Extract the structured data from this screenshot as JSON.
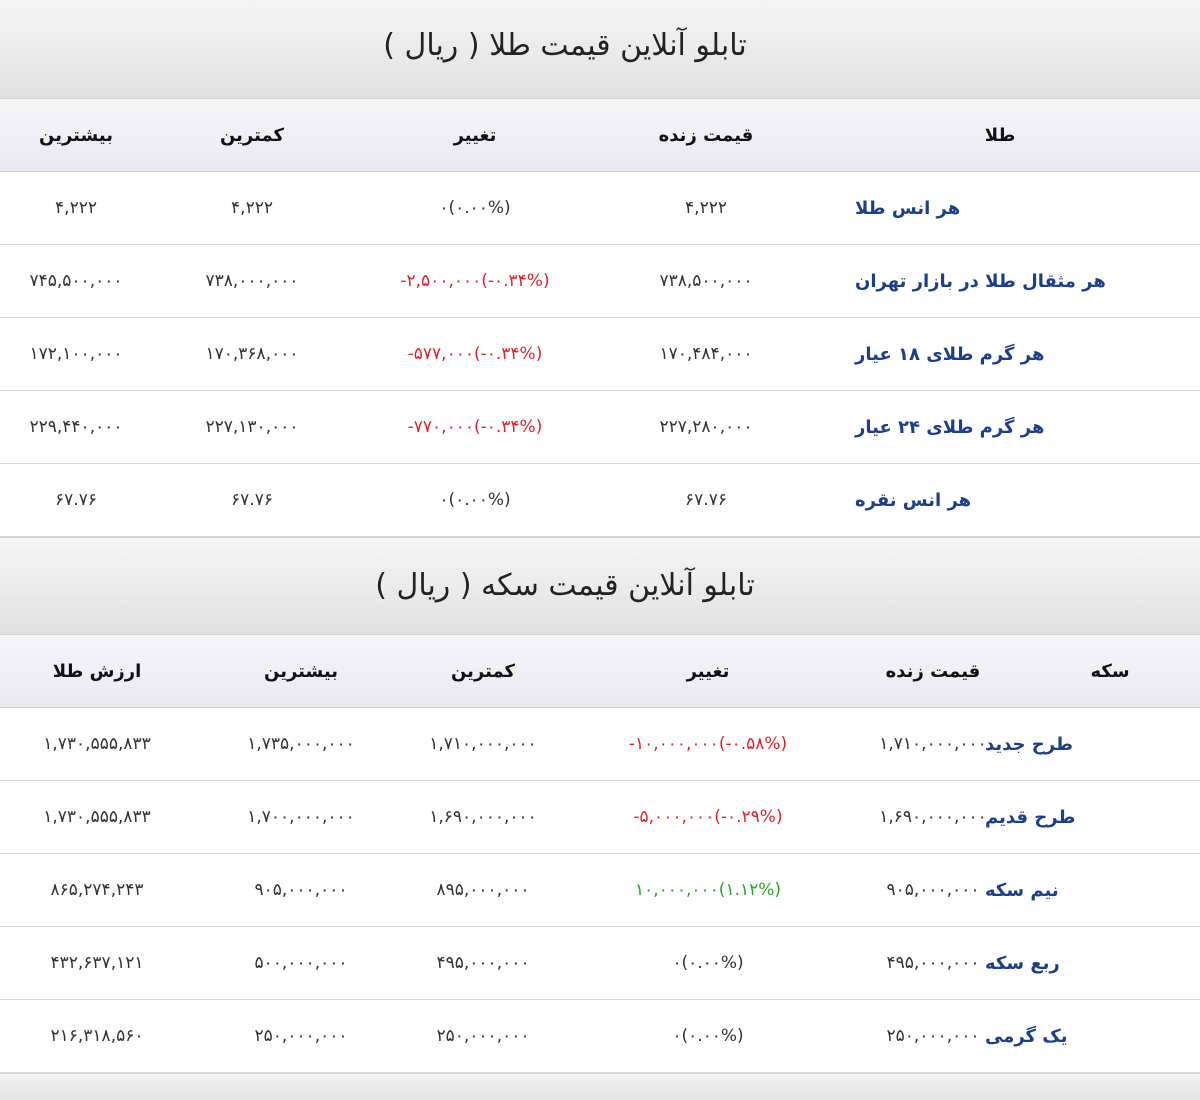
{
  "gold_board": {
    "title": "تابلو آنلاین قیمت طلا ( ریال )",
    "headers": {
      "name": "طلا",
      "live": "قیمت زنده",
      "change": "تغییر",
      "min": "کمترین",
      "max": "بیشترین"
    },
    "rows": [
      {
        "name": "هر انس طلا",
        "live": "۴,۲۲۲",
        "change": "۰(۰.۰۰%)",
        "min": "۴,۲۲۲",
        "max": "۴,۲۲۲"
      },
      {
        "name": "هر مثقال طلا در بازار تهران",
        "live": "۷۳۸,۵۰۰,۰۰۰",
        "change": "-۲,۵۰۰,۰۰۰(-۰.۳۴%)",
        "min": "۷۳۸,۰۰۰,۰۰۰",
        "max": "۷۴۵,۵۰۰,۰۰۰"
      },
      {
        "name": "هر گرم طلای ۱۸ عیار",
        "live": "۱۷۰,۴۸۴,۰۰۰",
        "change": "-۵۷۷,۰۰۰(-۰.۳۴%)",
        "min": "۱۷۰,۳۶۸,۰۰۰",
        "max": "۱۷۲,۱۰۰,۰۰۰"
      },
      {
        "name": "هر گرم طلای ۲۴ عیار",
        "live": "۲۲۷,۲۸۰,۰۰۰",
        "change": "-۷۷۰,۰۰۰(-۰.۳۴%)",
        "min": "۲۲۷,۱۳۰,۰۰۰",
        "max": "۲۲۹,۴۴۰,۰۰۰"
      },
      {
        "name": "هر انس نقره",
        "live": "۶۷.۷۶",
        "change": "۰(۰.۰۰%)",
        "min": "۶۷.۷۶",
        "max": "۶۷.۷۶"
      }
    ]
  },
  "coin_board": {
    "title": "تابلو آنلاین قیمت سکه ( ریال )",
    "headers": {
      "name": "سکه",
      "live": "قیمت زنده",
      "change": "تغییر",
      "min": "کمترین",
      "max": "بیشترین",
      "gold_value": "ارزش طلا"
    },
    "rows": [
      {
        "name": "طرح جدید",
        "live": "۱,۷۱۰,۰۰۰,۰۰۰",
        "change": "-۱۰,۰۰۰,۰۰۰(-۰.۵۸%)",
        "min": "۱,۷۱۰,۰۰۰,۰۰۰",
        "max": "۱,۷۳۵,۰۰۰,۰۰۰",
        "gold_value": "۱,۷۳۰,۵۵۵,۸۳۳"
      },
      {
        "name": "طرح قدیم",
        "live": "۱,۶۹۰,۰۰۰,۰۰۰",
        "change": "-۵,۰۰۰,۰۰۰(-۰.۲۹%)",
        "min": "۱,۶۹۰,۰۰۰,۰۰۰",
        "max": "۱,۷۰۰,۰۰۰,۰۰۰",
        "gold_value": "۱,۷۳۰,۵۵۵,۸۳۳"
      },
      {
        "name": "نیم سکه",
        "live": "۹۰۵,۰۰۰,۰۰۰",
        "change": "۱۰,۰۰۰,۰۰۰(۱.۱۲%)",
        "min": "۸۹۵,۰۰۰,۰۰۰",
        "max": "۹۰۵,۰۰۰,۰۰۰",
        "gold_value": "۸۶۵,۲۷۴,۲۴۳"
      },
      {
        "name": "ربع سکه",
        "live": "۴۹۵,۰۰۰,۰۰۰",
        "change": "۰(۰.۰۰%)",
        "min": "۴۹۵,۰۰۰,۰۰۰",
        "max": "۵۰۰,۰۰۰,۰۰۰",
        "gold_value": "۴۳۲,۶۳۷,۱۲۱"
      },
      {
        "name": "یک گرمی",
        "live": "۲۵۰,۰۰۰,۰۰۰",
        "change": "۰(۰.۰۰%)",
        "min": "۲۵۰,۰۰۰,۰۰۰",
        "max": "۲۵۰,۰۰۰,۰۰۰",
        "gold_value": "۲۱۶,۳۱۸,۵۶۰"
      }
    ]
  },
  "colors": {
    "negative": "#e0232b",
    "positive": "#2aa52a",
    "name_link": "#1d3f8a"
  }
}
